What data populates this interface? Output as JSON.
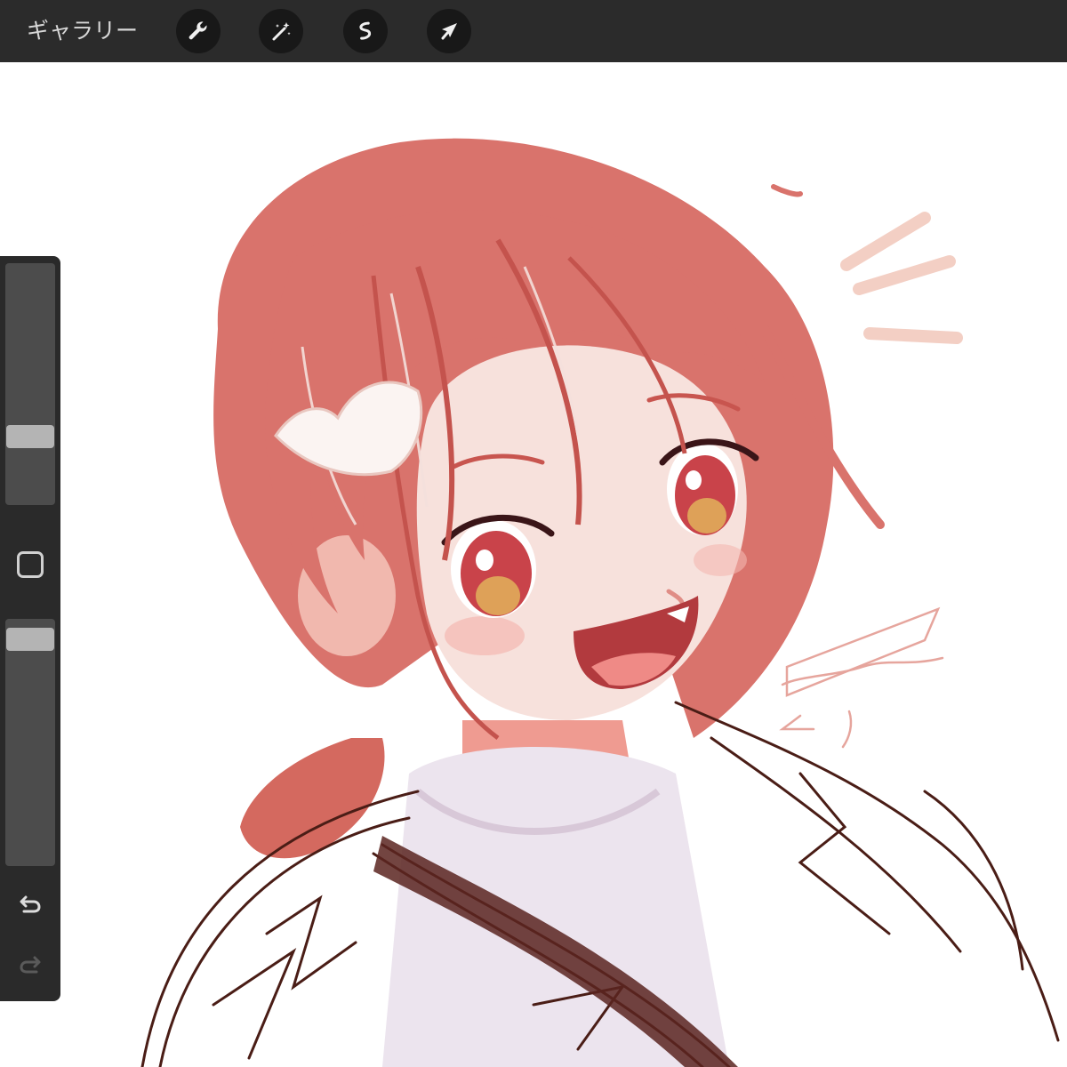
{
  "topbar": {
    "gallery_label": "ギャラリー",
    "tools": [
      {
        "name": "actions",
        "icon": "wrench-icon"
      },
      {
        "name": "adjustments",
        "icon": "magic-wand-icon"
      },
      {
        "name": "selection",
        "icon": "selection-s-icon"
      },
      {
        "name": "transform",
        "icon": "arrow-cursor-icon"
      }
    ]
  },
  "sidebar": {
    "brush_size_level": 0.26,
    "opacity_level": 0.96,
    "icons": [
      "modifier-square-icon",
      "undo-icon",
      "redo-icon"
    ]
  },
  "canvas": {
    "background_color": "#ffffff",
    "hair_color": "#d9736c",
    "hair_shadow_color": "#c9554f",
    "skin_color": "#f6d9d3",
    "sketch_line_color": "#4a1d16"
  },
  "colors": {
    "toolbar_bg": "#2b2b2b",
    "button_bg": "#181818",
    "sidebar_bg": "#2a2a2a",
    "slider_track": "#4c4c4c",
    "slider_thumb": "#b4b4b4"
  }
}
